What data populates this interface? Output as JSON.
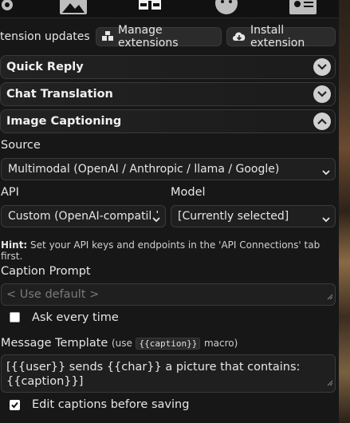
{
  "topbar": {
    "icons": [
      "gear-icon",
      "image-icon",
      "cubes-icon",
      "smile-icon",
      "id-card-icon"
    ]
  },
  "extensions": {
    "updates_text": "tension updates",
    "manage_label": "Manage extensions",
    "install_label": "Install extension"
  },
  "drawers": {
    "quick_reply": "Quick Reply",
    "chat_translation": "Chat Translation",
    "image_captioning": "Image Captioning"
  },
  "captioning": {
    "source_label": "Source",
    "source_value": "Multimodal (OpenAI / Anthropic / llama / Google)",
    "api_label": "API",
    "api_value": "Custom (OpenAI-compatibl",
    "model_label": "Model",
    "model_value": "[Currently selected]",
    "hint_bold": "Hint:",
    "hint_text": " Set your API keys and endpoints in the 'API Connections' tab first.",
    "caption_prompt_label": "Caption Prompt",
    "caption_prompt_placeholder": "< Use default >",
    "ask_every_time_label": "Ask every time",
    "ask_every_time_checked": false,
    "message_template_label": "Message Template",
    "message_template_use": "(use",
    "message_template_macro": "{{caption}}",
    "message_template_after": "macro)",
    "message_template_value": "[{{user}} sends {{char}} a picture that contains: {{caption}}]",
    "edit_before_saving_label": "Edit captions before saving",
    "edit_before_saving_checked": true
  },
  "colors": {
    "panel_bg": "#171717",
    "field_bg": "#1f1f1f",
    "border": "#3a3a3a",
    "chevron_bg": "#d0d0d0",
    "checkbox_checked": "#ffffff"
  }
}
